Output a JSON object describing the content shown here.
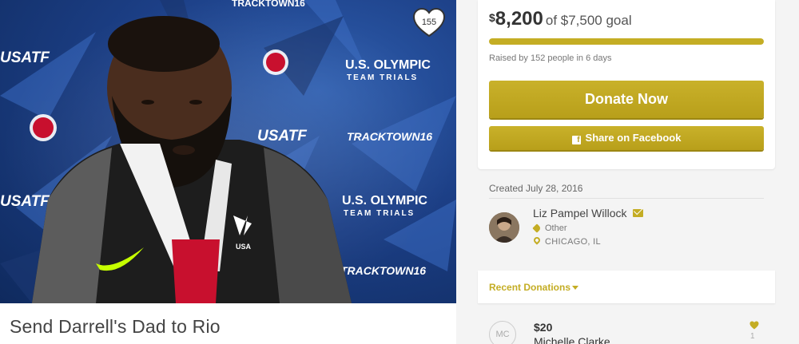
{
  "hero": {
    "alt": "Athlete interview in front of U.S. Olympic Team Trials backdrop",
    "hearts": "155",
    "banner_texts": [
      "USATF",
      "U.S. OLYMPIC",
      "TEAM TRIALS",
      "USATF",
      "TRACKTOWN16",
      "U.S. OLYMPIC",
      "TEAM TRIALS",
      "USATF",
      "TRACKTOWN16",
      "TRACKTOWN16"
    ]
  },
  "campaign": {
    "title": "Send Darrell's Dad to Rio"
  },
  "funding": {
    "currency_symbol": "$",
    "raised": "8,200",
    "goal_text": "of $7,500 goal",
    "progress_fraction": 1.0,
    "raised_by": "Raised by 152 people in 6 days"
  },
  "actions": {
    "donate_label": "Donate Now",
    "share_label": "Share on Facebook",
    "fb_glyph": "f"
  },
  "organizer": {
    "created": "Created July 28, 2016",
    "name": "Liz Pampel Willock",
    "category": "Other",
    "location": "CHICAGO, IL"
  },
  "recent": {
    "label": "Recent Donations"
  },
  "donations": [
    {
      "initials": "MC",
      "amount": "$20",
      "name": "Michelle Clarke",
      "likes": "1"
    }
  ],
  "colors": {
    "accent": "#c4ad24",
    "background": "#f4f4f4",
    "card": "#ffffff"
  }
}
